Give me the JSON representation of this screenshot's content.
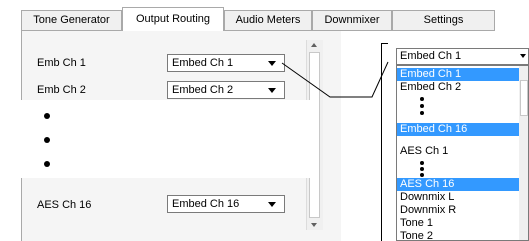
{
  "tabs": [
    {
      "label": "Tone Generator",
      "active": false
    },
    {
      "label": "Output Routing",
      "active": true
    },
    {
      "label": "Audio Meters",
      "active": false
    },
    {
      "label": "Downmixer",
      "active": false
    },
    {
      "label": "Settings",
      "active": false
    }
  ],
  "rows": [
    {
      "label": "Emb Ch 1",
      "value": "Embed Ch 1"
    },
    {
      "label": "Emb Ch 2",
      "value": "Embed Ch 2"
    },
    {
      "label": "AES Ch 16",
      "value": "Embed Ch 16"
    }
  ],
  "dropdown": {
    "current": "Embed Ch 1",
    "options": [
      "Embed Ch 1",
      "Embed Ch 2",
      "Embed Ch 16",
      "AES Ch 1",
      "AES Ch 16",
      "Downmix L",
      "Downmix R",
      "Tone 1",
      "Tone 2"
    ],
    "highlighted": [
      "Embed Ch 1",
      "Embed Ch 16",
      "AES Ch 16"
    ]
  },
  "colors": {
    "selection": "#3399ff",
    "panel": "#f5f5f5"
  }
}
